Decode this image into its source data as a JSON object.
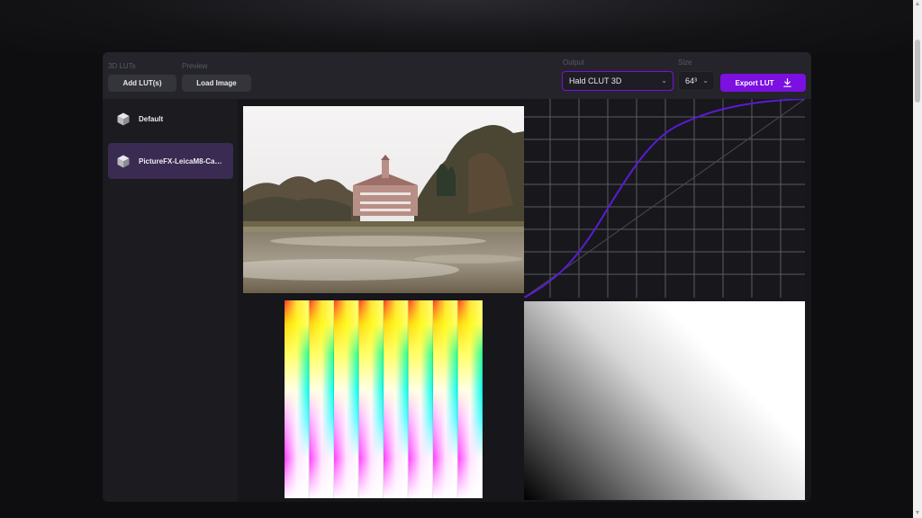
{
  "toolbar": {
    "luts_label": "3D LUTs",
    "preview_label": "Preview",
    "add_luts_label": "Add LUT(s)",
    "load_image_label": "Load Image",
    "output_label": "Output",
    "output_value": "Hald CLUT 3D",
    "size_label": "Size",
    "size_value": "64³",
    "export_label": "Export LUT"
  },
  "luts": [
    {
      "name": "Default",
      "selected": false
    },
    {
      "name": "PictureFX-LeicaM8-Ca…",
      "selected": true
    }
  ],
  "colors": {
    "accent": "#7b10e0",
    "curve": "#5a1bd6",
    "selected_item": "#3a2b52",
    "panel_bg": "#1b1b20"
  },
  "icons": [
    "cube-icon",
    "download-icon",
    "chevron-down-icon"
  ]
}
